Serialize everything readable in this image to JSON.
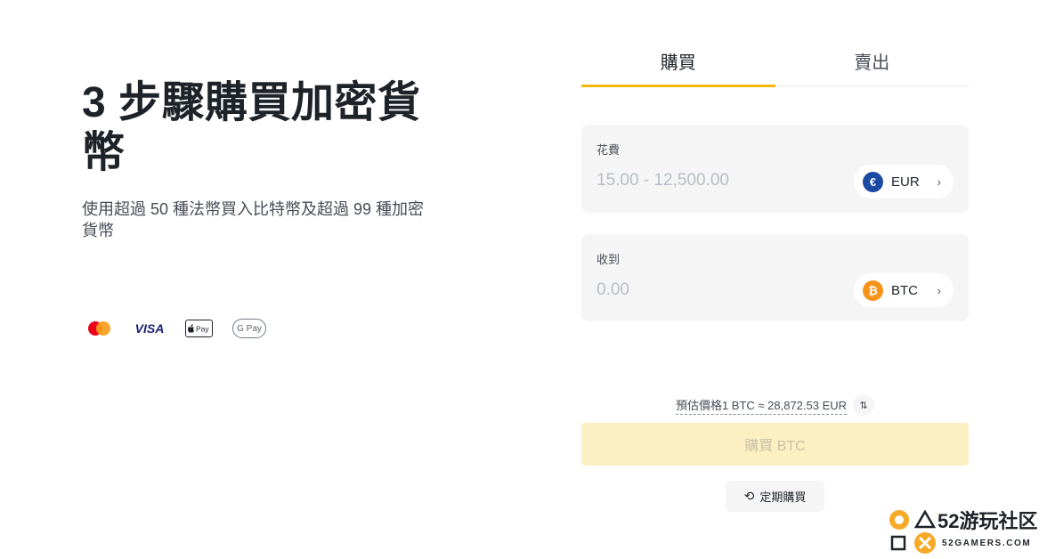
{
  "hero": {
    "title": "3 步驟購買加密貨幣",
    "subtitle": "使用超過 50 種法幣買入比特幣及超過 99 種加密貨幣"
  },
  "payment_methods": {
    "visa": "VISA",
    "apple_pay": "Pay",
    "google_pay": "G Pay"
  },
  "tabs": {
    "buy": "購買",
    "sell": "賣出",
    "active": "buy"
  },
  "spend": {
    "label": "花費",
    "placeholder": "15.00 - 12,500.00",
    "currency": "EUR",
    "currency_symbol": "€"
  },
  "receive": {
    "label": "收到",
    "placeholder": "0.00",
    "currency": "BTC",
    "currency_symbol": "₿"
  },
  "estimate": {
    "text": "預估價格1 BTC ≈ 28,872.53 EUR"
  },
  "buy_button": {
    "label": "購買 BTC"
  },
  "recurring": {
    "label": "定期購買"
  },
  "watermark": {
    "title": "52游玩社区",
    "subtitle": "52GAMERS.COM"
  },
  "colors": {
    "accent": "#f0b90b",
    "buy_button_bg": "#fcf0c3",
    "eur_icon": "#1c4aa2",
    "btc_icon": "#f7931a"
  }
}
